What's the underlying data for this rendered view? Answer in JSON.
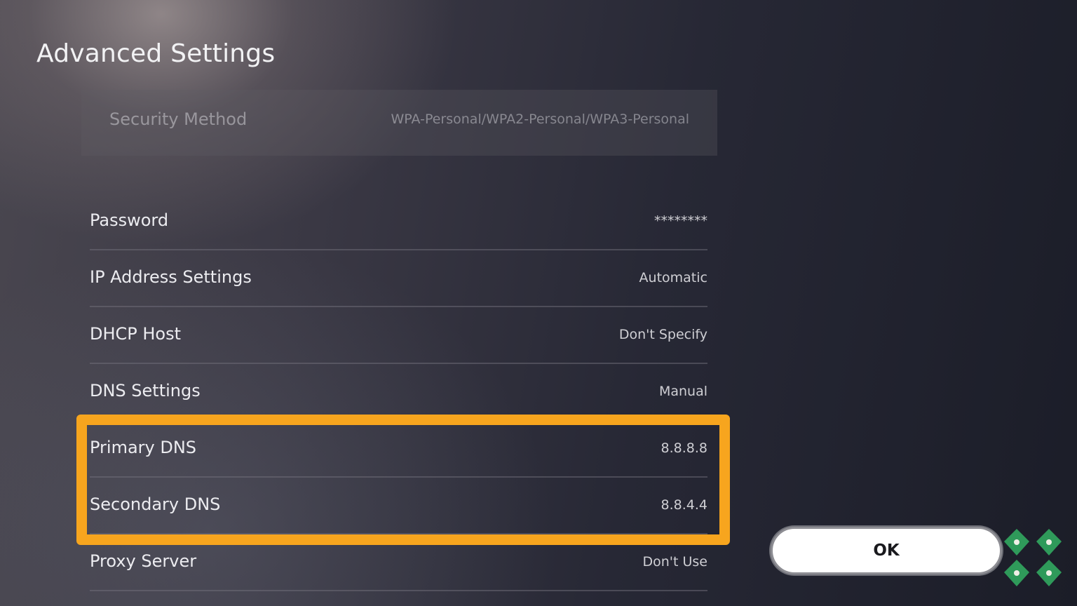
{
  "page": {
    "title": "Advanced Settings"
  },
  "security": {
    "label": "Security Method",
    "value": "WPA-Personal/WPA2-Personal/WPA3-Personal"
  },
  "settings": [
    {
      "label": "Password",
      "value": "********"
    },
    {
      "label": "IP Address Settings",
      "value": "Automatic"
    },
    {
      "label": "DHCP Host",
      "value": "Don't Specify"
    },
    {
      "label": "DNS Settings",
      "value": "Manual"
    },
    {
      "label": "Primary DNS",
      "value": "8.8.8.8"
    },
    {
      "label": "Secondary DNS",
      "value": "8.8.4.4"
    },
    {
      "label": "Proxy Server",
      "value": "Don't Use"
    }
  ],
  "actions": {
    "ok_label": "OK"
  },
  "colors": {
    "highlight": "#f7a51e",
    "logo": "#2f9a5a"
  },
  "icons": {
    "logo": "four-leaf-logo-icon"
  }
}
